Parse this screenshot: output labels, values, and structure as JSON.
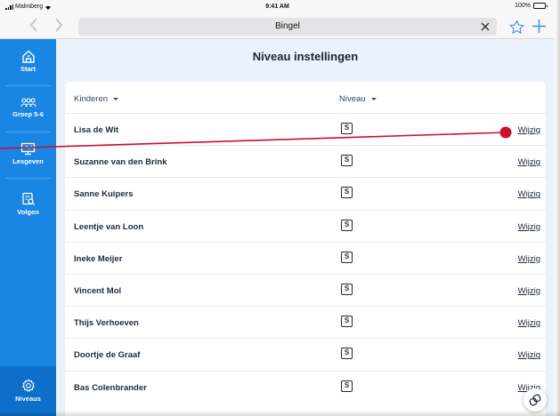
{
  "status": {
    "carrier": "Malmberg",
    "time": "9:41 AM",
    "battery": "100%",
    "battery_level": 1.0
  },
  "browser": {
    "url_title": "Bingel",
    "back_icon": "chevron-left-icon",
    "forward_icon": "chevron-right-icon",
    "clear_icon": "close-icon",
    "bookmark_icon": "star-icon",
    "new_tab_icon": "plus-icon"
  },
  "sidebar": {
    "items": [
      {
        "label": "Start",
        "icon": "home-icon"
      },
      {
        "label": "Groep 5-6",
        "icon": "group-icon"
      },
      {
        "label": "Lesgeven",
        "icon": "presentation-icon"
      },
      {
        "label": "Volgen",
        "icon": "track-icon"
      },
      {
        "label": "Niveaus",
        "icon": "gear-icon",
        "active": true
      }
    ]
  },
  "main": {
    "title": "Niveau instellingen",
    "columns": {
      "kids": "Kinderen",
      "level": "Niveau"
    },
    "rows": [
      {
        "name": "Lisa de Wit",
        "level": "S",
        "action": "Wijzig"
      },
      {
        "name": "Suzanne van den Brink",
        "level": "S",
        "action": "Wijzig"
      },
      {
        "name": "Sanne Kuipers",
        "level": "S",
        "action": "Wijzig"
      },
      {
        "name": "Leentje van Loon",
        "level": "S",
        "action": "Wijzig"
      },
      {
        "name": "Ineke Meijer",
        "level": "S",
        "action": "Wijzig"
      },
      {
        "name": "Vincent Mol",
        "level": "S",
        "action": "Wijzig"
      },
      {
        "name": "Thijs Verhoeven",
        "level": "S",
        "action": "Wijzig"
      },
      {
        "name": "Doortje de Graaf",
        "level": "S",
        "action": "Wijzig"
      },
      {
        "name": "Bas Colenbrander",
        "level": "S",
        "action": "Wijzig"
      }
    ]
  },
  "colors": {
    "sidebar": "#1a86e4",
    "sidebar_active": "#0d6fc9",
    "main_bg": "#eaf3fd",
    "accent": "#3a8de8",
    "annotation_line": "#c8102e"
  },
  "float_button_icon": "link-icon"
}
